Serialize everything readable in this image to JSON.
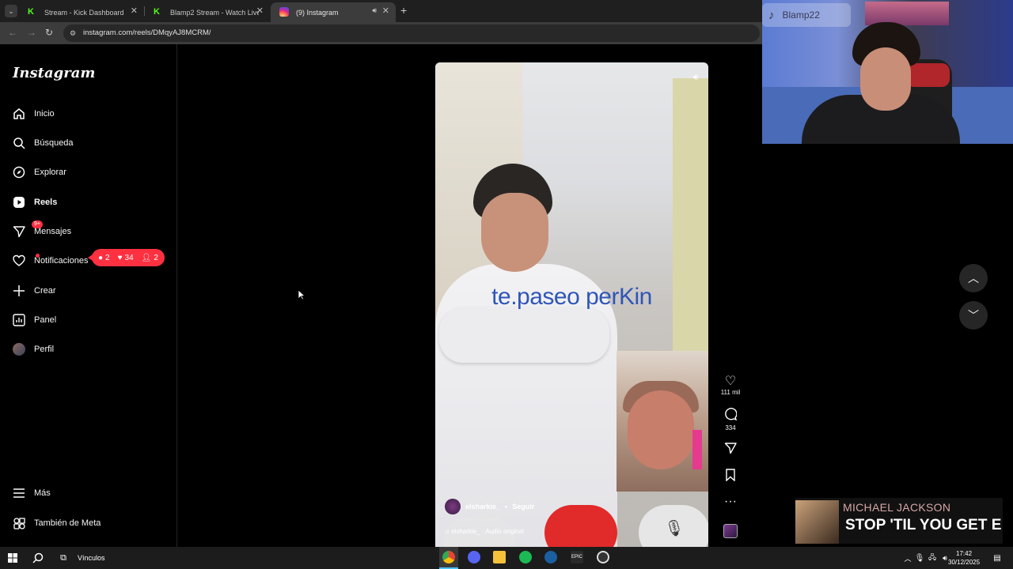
{
  "browser": {
    "tabs": [
      {
        "title": "Stream - Kick Dashboard",
        "favicon_color": "#53fc18"
      },
      {
        "title": "Blamp2 Stream - Watch Live on",
        "favicon_color": "#53fc18"
      },
      {
        "title": "(9) Instagram",
        "favicon_color": "#e1306c"
      }
    ],
    "url": "instagram.com/reels/DMqyAJ8MCRM/"
  },
  "instagram": {
    "logo": "Instagram",
    "nav": [
      {
        "label": "Inicio",
        "icon": "home-icon"
      },
      {
        "label": "Búsqueda",
        "icon": "search-icon"
      },
      {
        "label": "Explorar",
        "icon": "compass-icon"
      },
      {
        "label": "Reels",
        "icon": "reels-icon"
      },
      {
        "label": "Mensajes",
        "icon": "send-icon",
        "badge": "9+"
      },
      {
        "label": "Notificaciones",
        "icon": "heart-icon"
      },
      {
        "label": "Crear",
        "icon": "plus-icon"
      },
      {
        "label": "Panel",
        "icon": "chart-icon"
      },
      {
        "label": "Perfil",
        "icon": "avatar"
      }
    ],
    "bottom_nav": [
      {
        "label": "Más",
        "icon": "menu-icon"
      },
      {
        "label": "También de Meta",
        "icon": "meta-icon"
      }
    ],
    "notifications_pill": {
      "comments": "2",
      "likes": "34",
      "follows": "2"
    },
    "reel": {
      "overlay_text": "te.paseo perKin",
      "author": "elsharkie_",
      "follow_label": "Seguir",
      "audio": "elsharkie_ · Audio original",
      "likes": "111 mil",
      "comments": "334"
    }
  },
  "stream_overlay": {
    "tiktok_handle": "Blamp22",
    "music_artist": "MICHAEL JACKSON",
    "music_song": "STOP 'TIL YOU GET E"
  },
  "taskbar": {
    "vinculos_label": "Vínculos",
    "time": "17:42",
    "date": "30/12/2025"
  }
}
